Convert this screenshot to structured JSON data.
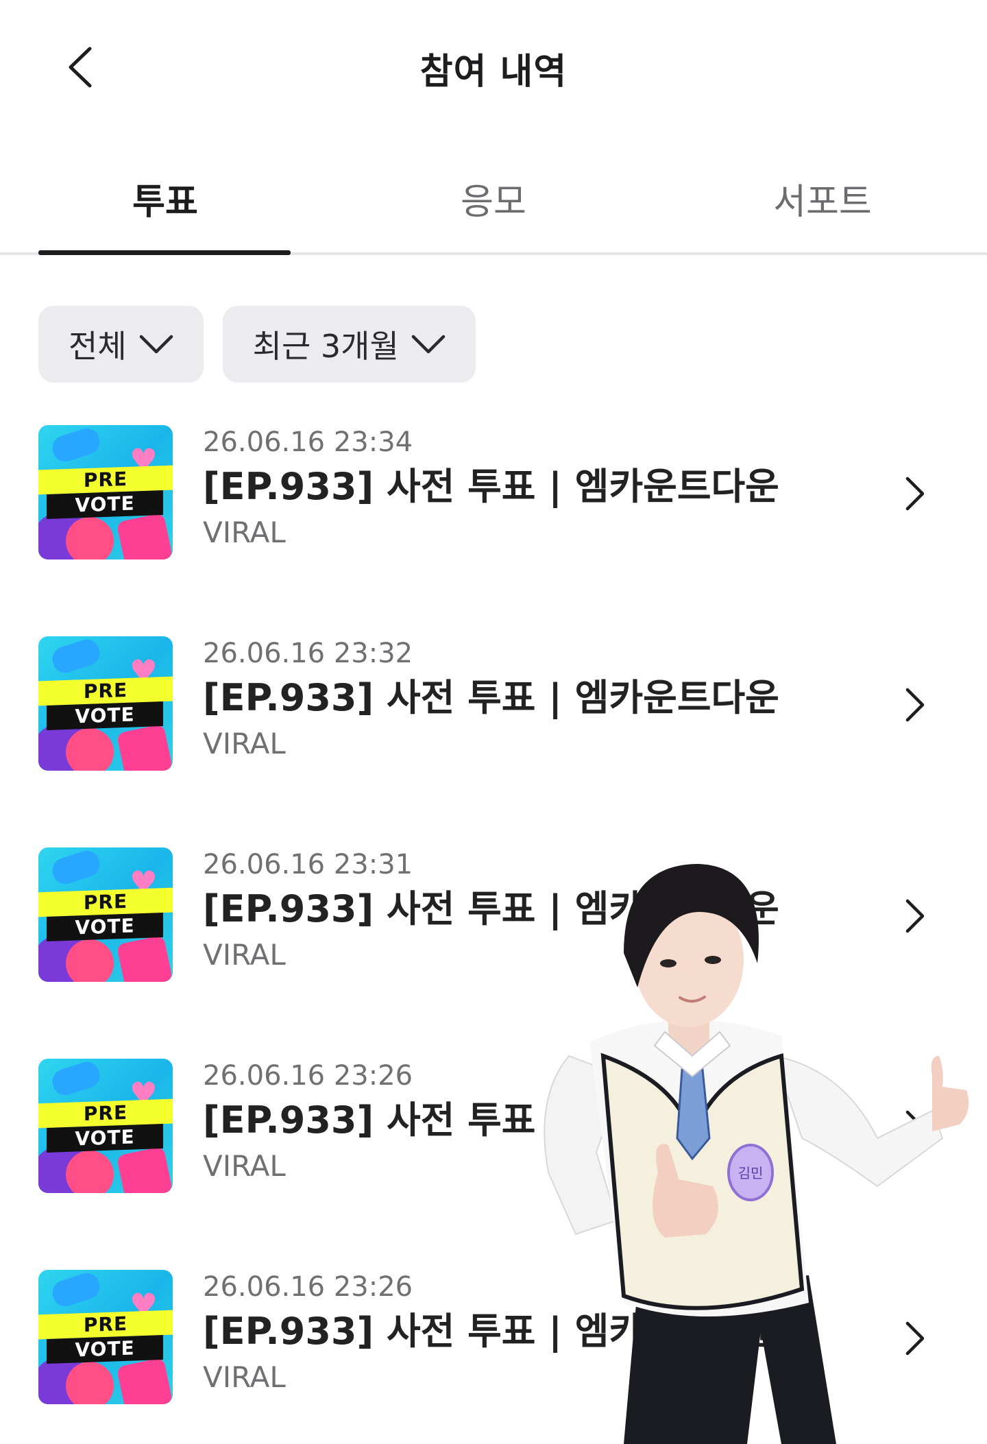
{
  "header": {
    "title": "참여 내역"
  },
  "tabs": [
    {
      "label": "투표",
      "active": true
    },
    {
      "label": "응모",
      "active": false
    },
    {
      "label": "서포트",
      "active": false
    }
  ],
  "filters": [
    {
      "label": "전체"
    },
    {
      "label": "최근 3개월"
    }
  ],
  "thumbnail": {
    "line1": "PRE",
    "line2": "VOTE"
  },
  "items": [
    {
      "date": "26.06.16 23:34",
      "title": "[EP.933] 사전 투표 | 엠카운트다운",
      "org": "VIRAL"
    },
    {
      "date": "26.06.16 23:32",
      "title": "[EP.933] 사전 투표 | 엠카운트다운",
      "org": "VIRAL"
    },
    {
      "date": "26.06.16 23:31",
      "title": "[EP.933] 사전 투표 | 엠카운트다운",
      "org": "VIRAL"
    },
    {
      "date": "26.06.16 23:26",
      "title": "[EP.933] 사전 투표 | 엠카운트다운",
      "org": "VIRAL"
    },
    {
      "date": "26.06.16 23:26",
      "title": "[EP.933] 사전 투표 | 엠카운트다운",
      "org": "VIRAL"
    }
  ],
  "overlay": {
    "name_tag": "김민"
  },
  "colors": {
    "text": "#1d1d1f",
    "muted": "#6f6f74",
    "chip_bg": "#ececf0",
    "indicator": "#1d1d1f"
  }
}
